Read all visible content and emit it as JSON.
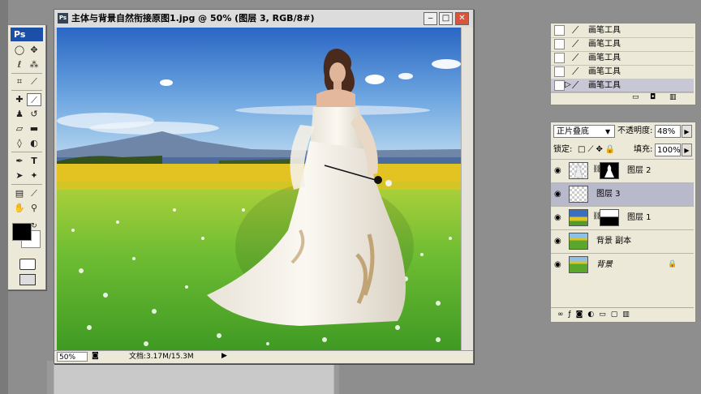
{
  "document": {
    "title": "主体与背景自然衔接原图1.jpg @ 50% (图层 3, RGB/8#)",
    "zoom": "50%",
    "info": "文档:3.17M/15.3M"
  },
  "toolbox": {
    "logo": "Ps",
    "tools": [
      "marquee-tool",
      "move-tool",
      "lasso-tool",
      "magic-wand-tool",
      "crop-tool",
      "slice-tool",
      "healing-brush-tool",
      "brush-tool",
      "clone-stamp-tool",
      "history-brush-tool",
      "eraser-tool",
      "gradient-tool",
      "blur-tool",
      "dodge-tool",
      "pen-tool",
      "type-tool",
      "path-select-tool",
      "shape-tool",
      "notes-tool",
      "eyedropper-tool",
      "hand-tool",
      "zoom-tool"
    ],
    "foreground_color": "#000000",
    "background_color": "#ffffff"
  },
  "history_panel": {
    "items": [
      {
        "label": "画笔工具"
      },
      {
        "label": "画笔工具"
      },
      {
        "label": "画笔工具"
      },
      {
        "label": "画笔工具"
      },
      {
        "label": "画笔工具",
        "selected": true
      }
    ]
  },
  "layers_panel": {
    "blend_mode": "正片叠底",
    "opacity_label": "不透明度:",
    "opacity": "48%",
    "lock_label": "锁定:",
    "fill_label": "填充:",
    "fill": "100%",
    "layers": [
      {
        "name": "图层 2",
        "has_mask": true,
        "selected": false
      },
      {
        "name": "图层 3",
        "has_mask": false,
        "selected": true
      },
      {
        "name": "图层 1",
        "has_mask": true,
        "selected": false
      },
      {
        "name": "背景 副本",
        "has_mask": false,
        "selected": false
      },
      {
        "name": "背景",
        "has_mask": false,
        "selected": false,
        "locked": true
      }
    ]
  },
  "colors": {
    "sky_top": "#2c69c7",
    "sky_bottom": "#9cc6ec",
    "field_yellow": "#e9c91f",
    "grass": "#5cae2a",
    "selection": "#b9b9cc"
  }
}
